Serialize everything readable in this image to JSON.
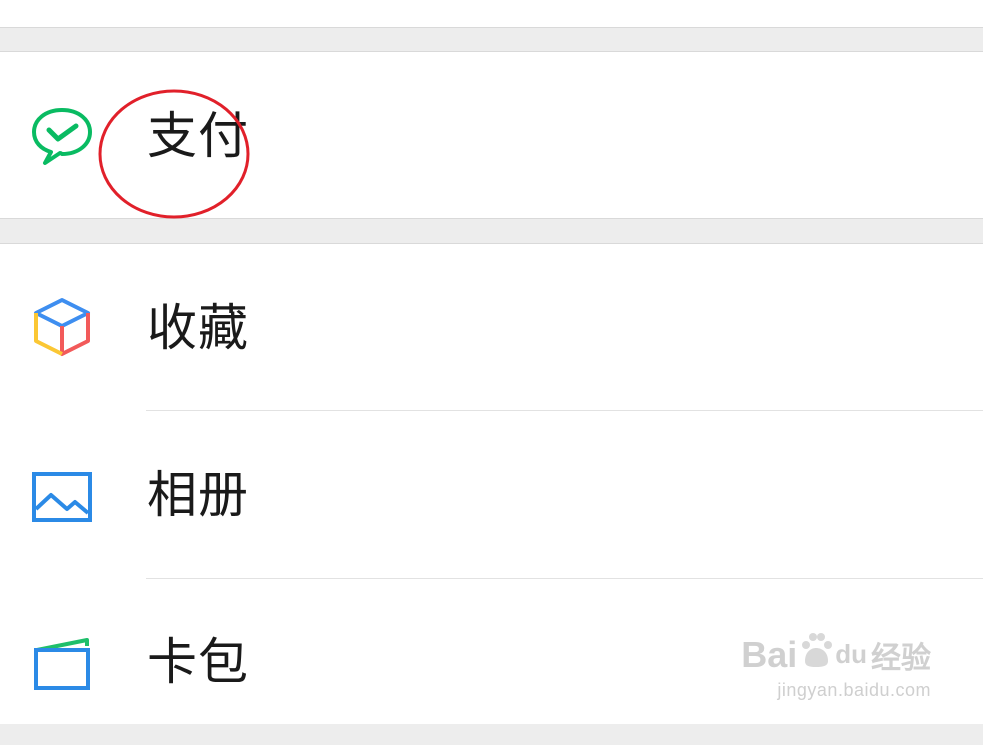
{
  "menu": {
    "pay": {
      "label": "支付",
      "icon": "wechat-pay-icon"
    },
    "items": [
      {
        "label": "收藏",
        "icon": "favorites-cube-icon"
      },
      {
        "label": "相册",
        "icon": "album-picture-icon"
      },
      {
        "label": "卡包",
        "icon": "card-wallet-icon"
      }
    ]
  },
  "watermark": {
    "brand_left": "Bai",
    "brand_mid": "du",
    "brand_right": "经验",
    "url": "jingyan.baidu.com"
  },
  "colors": {
    "pay_green": "#09bb62",
    "favorites_blue": "#3e8ef0",
    "favorites_red": "#f25a5a",
    "favorites_yellow": "#fbc734",
    "album_blue": "#2b8ae6",
    "card_blue": "#2b8ae6",
    "card_green": "#1fbf6b",
    "annotation_red": "#e1202a"
  }
}
